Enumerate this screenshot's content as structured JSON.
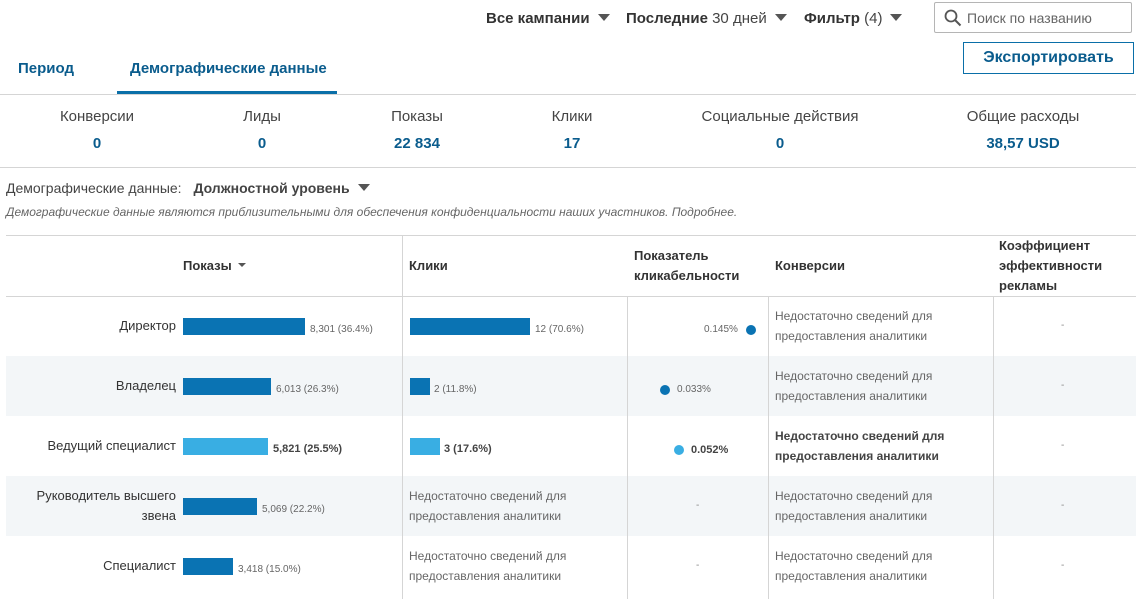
{
  "topbar": {
    "campaigns": "Все кампании",
    "period_prefix": "Последние",
    "period_value": "30 дней",
    "filter_label": "Фильтр",
    "filter_count": "(4)",
    "search_placeholder": "Поиск по названию"
  },
  "tabs": [
    "Период",
    "Демографические данные"
  ],
  "export_label": "Экспортировать",
  "stats": [
    {
      "label": "Конверсии",
      "value": "0"
    },
    {
      "label": "Лиды",
      "value": "0"
    },
    {
      "label": "Показы",
      "value": "22 834"
    },
    {
      "label": "Клики",
      "value": "17"
    },
    {
      "label": "Социальные действия",
      "value": "0"
    },
    {
      "label": "Общие расходы",
      "value": "38,57 USD"
    }
  ],
  "demographics": {
    "label": "Демографические данные:",
    "selected": "Должностной уровень",
    "note": "Демографические данные являются приблизительными для обеспечения конфиденциальности наших участников. Подробнее."
  },
  "table": {
    "headers": {
      "impressions": "Показы",
      "clicks": "Клики",
      "ctr_line1": "Показатель",
      "ctr_line2": "кликабельности",
      "conversions": "Конверсии",
      "roas_line1": "Коэффициент",
      "roas_line2": "эффективности",
      "roas_line3": "рекламы"
    },
    "insufficient_line1": "Недостаточно сведений для",
    "insufficient_line2": "предоставления аналитики",
    "dash": "-",
    "rows": [
      {
        "label_line1": "Директор",
        "label_line2": "",
        "impressions": "8,301 (36.4%)",
        "impressions_share": 0.364,
        "clicks": "12 (70.6%)",
        "clicks_share": 0.706,
        "ctr": "0.145%",
        "ctr_value": 0.145,
        "color": "#0a73b3"
      },
      {
        "label_line1": "Владелец",
        "label_line2": "",
        "impressions": "6,013 (26.3%)",
        "impressions_share": 0.263,
        "clicks": "2 (11.8%)",
        "clicks_share": 0.118,
        "ctr": "0.033%",
        "ctr_value": 0.033,
        "color": "#0a73b3"
      },
      {
        "label_line1": "Ведущий специалист",
        "label_line2": "",
        "impressions": "5,821 (25.5%)",
        "impressions_share": 0.255,
        "clicks": "3 (17.6%)",
        "clicks_share": 0.176,
        "ctr": "0.052%",
        "ctr_value": 0.052,
        "color": "#39aee3"
      },
      {
        "label_line1": "Руководитель высшего",
        "label_line2": "звена",
        "impressions": "5,069 (22.2%)",
        "impressions_share": 0.222,
        "clicks": null,
        "clicks_share": null,
        "ctr": null,
        "ctr_value": null,
        "color": "#0a73b3"
      },
      {
        "label_line1": "Специалист",
        "label_line2": "",
        "impressions": "3,418 (15.0%)",
        "impressions_share": 0.15,
        "clicks": null,
        "clicks_share": null,
        "ctr": null,
        "ctr_value": null,
        "color": "#0a73b3"
      }
    ]
  }
}
